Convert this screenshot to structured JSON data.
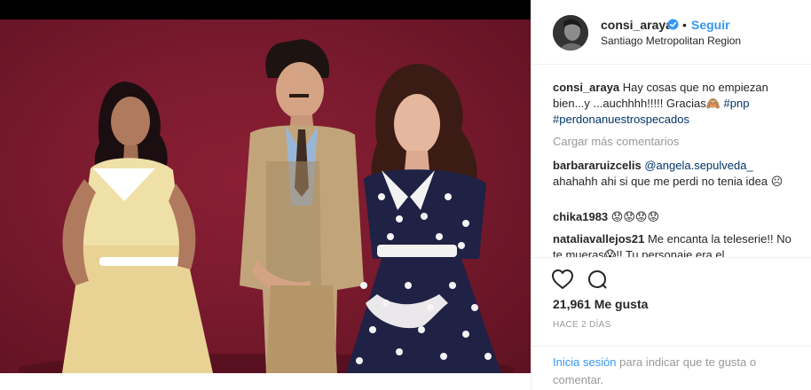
{
  "post": {
    "username": "consi_araya",
    "separator": "•",
    "follow_label": "Seguir",
    "location": "Santiago Metropolitan Region",
    "verified": true,
    "caption_username": "consi_araya",
    "caption_text": "Hay cosas que no empiezan bien...y ...auchhhh!!!!! Gracias🙈",
    "caption_hashtags": [
      "#pnp",
      "#perdonanuestrospecados"
    ],
    "load_more_label": "Cargar más comentarios",
    "likes_text": "21,961 Me gusta",
    "time_text": "HACE 2 DÍAS",
    "login_link": "Inicia sesión",
    "login_rest": "para indicar que te gusta o comentar."
  },
  "comments": [
    {
      "username": "barbararuizcelis",
      "mention": "@angela.sepulveda_",
      "text": "ahahahh ahi si que me perdi no tenia idea ☹"
    },
    {
      "username": "chika1983",
      "text": "😟😟😟😟"
    },
    {
      "username": "nataliavallejos21",
      "text": "Me encanta la teleserie!! No te mueras😱!! Tu personaje era el"
    }
  ],
  "carousel": {
    "count": 2,
    "active_index": 1
  },
  "colors": {
    "accent": "#3897f0",
    "link": "#003569",
    "muted": "#999999",
    "text": "#262626",
    "backdrop": "#7a1a2e"
  },
  "icons": [
    "verified-badge-icon",
    "heart-icon",
    "comment-icon"
  ]
}
